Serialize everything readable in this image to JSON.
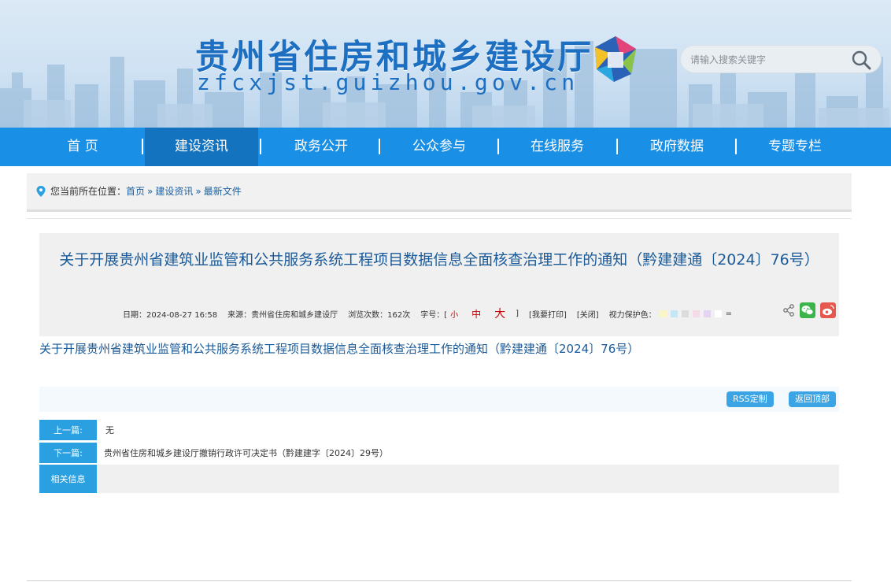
{
  "header": {
    "site_title": "贵州省住房和城乡建设厅",
    "site_url": "zfcxjst.guizhou.gov.cn",
    "search_placeholder": "请输入搜索关键字"
  },
  "nav": {
    "items": [
      {
        "label": "首 页"
      },
      {
        "label": "建设资讯"
      },
      {
        "label": "政务公开"
      },
      {
        "label": "公众参与"
      },
      {
        "label": "在线服务"
      },
      {
        "label": "政府数据"
      },
      {
        "label": "专题专栏"
      }
    ],
    "active": "建设资讯"
  },
  "breadcrumb": {
    "prefix": "您当前所在位置：",
    "items": [
      "首页",
      "建设资讯",
      "最新文件"
    ],
    "separator": "»"
  },
  "article": {
    "title": "关于开展贵州省建筑业监管和公共服务系统工程项目数据信息全面核查治理工作的通知（黔建建通〔2024〕76号）",
    "date": "日期：2024-08-27 16:58",
    "source": "来源：贵州省住房和城乡建设厅",
    "views": "浏览次数：162次",
    "font_size_label": "字号：[",
    "font_small": "小",
    "font_mid": "中",
    "font_big": "大",
    "font_close": "]",
    "print": "[我要打印]",
    "close": "[关闭]",
    "eye_care_label": "视力保护色：",
    "eye_care_reset": "=",
    "eye_colors": [
      "#faf6c8",
      "#c5e6f5",
      "#dcdcdc",
      "#f3dbe8",
      "#e3d5f1",
      "#ffffff"
    ],
    "body_link": "关于开展贵州省建筑业监管和公共服务系统工程项目数据信息全面核查治理工作的通知（黔建建通〔2024〕76号）"
  },
  "tools": {
    "rss": "RSS定制",
    "back_top": "返回顶部"
  },
  "prev_next": {
    "prev_label": "上一篇:",
    "prev_value": "无",
    "next_label": "下一篇:",
    "next_value": "贵州省住房和城乡建设厅撤销行政许可决定书（黔建建字〔2024〕29号）",
    "related_label": "相关信息"
  },
  "colors": {
    "nav_bg": "#1a8fe6",
    "nav_active": "#1473bf",
    "accent": "#2ba0e0",
    "title_blue": "#1a5a98"
  }
}
